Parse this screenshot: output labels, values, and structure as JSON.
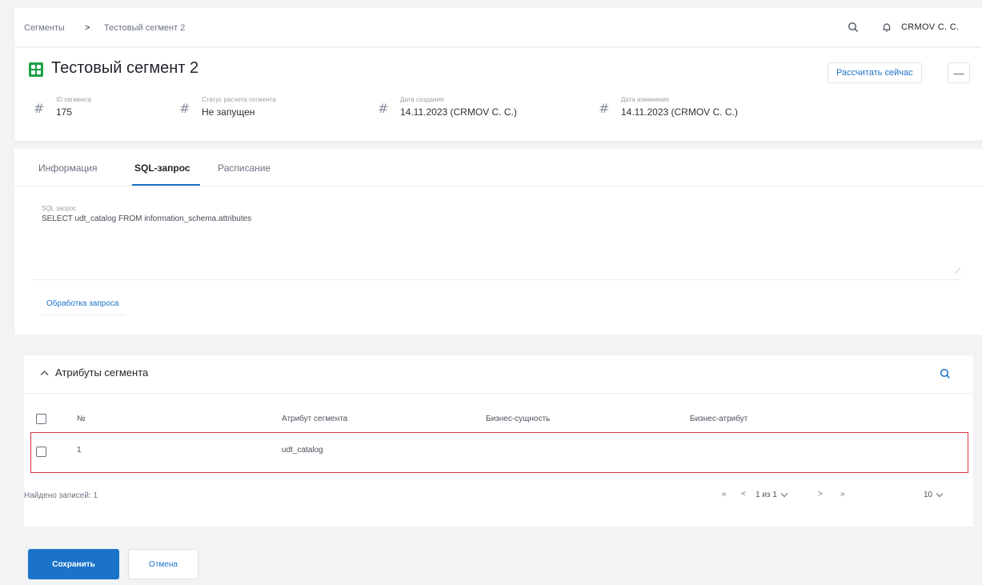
{
  "breadcrumb": {
    "root": "Сегменты",
    "separator": ">",
    "current": "Тестовый сегмент 2"
  },
  "topbar": {
    "search_icon": "search-icon",
    "bell_icon": "bell-icon",
    "user": "CRMOV C. C."
  },
  "header": {
    "title": "Тестовый сегмент 2",
    "calc_button": "Рассчитать сейчас",
    "more_button": "—",
    "meta": [
      {
        "label": "ID сегмента",
        "value": "175"
      },
      {
        "label": "Статус расчета сегмента",
        "value": "Не запущен"
      },
      {
        "label": "Дата создания",
        "value": "14.11.2023 (CRMOV C. C.)"
      },
      {
        "label": "Дата изменения",
        "value": "14.11.2023 (CRMOV C. C.)"
      }
    ]
  },
  "tabs": [
    {
      "label": "Информация"
    },
    {
      "label": "SQL-запрос"
    },
    {
      "label": "Расписание"
    }
  ],
  "sql": {
    "label": "SQL запрос",
    "value": "SELECT udt_catalog FROM information_schema.attributes",
    "process_link": "Обработка запроса"
  },
  "attributes": {
    "title": "Атрибуты сегмента",
    "columns": [
      "№",
      "Атрибут сегмента",
      "Бизнес-сущность",
      "Бизнес-атрибут"
    ],
    "rows": [
      {
        "num": "1",
        "attribute": "udt_catalog",
        "entity": "",
        "business_attribute": ""
      }
    ],
    "found_label": "Найдено записей:",
    "found_count": "1",
    "pager": {
      "first": "«",
      "prev": "<",
      "page": "1 из 1",
      "next": ">",
      "last": "»",
      "page_size": "10"
    }
  },
  "footer": {
    "save": "Сохранить",
    "cancel": "Отмена"
  },
  "colors": {
    "accent": "#1a73c9",
    "brand": "#1aa147",
    "selection": "#d9343c"
  }
}
